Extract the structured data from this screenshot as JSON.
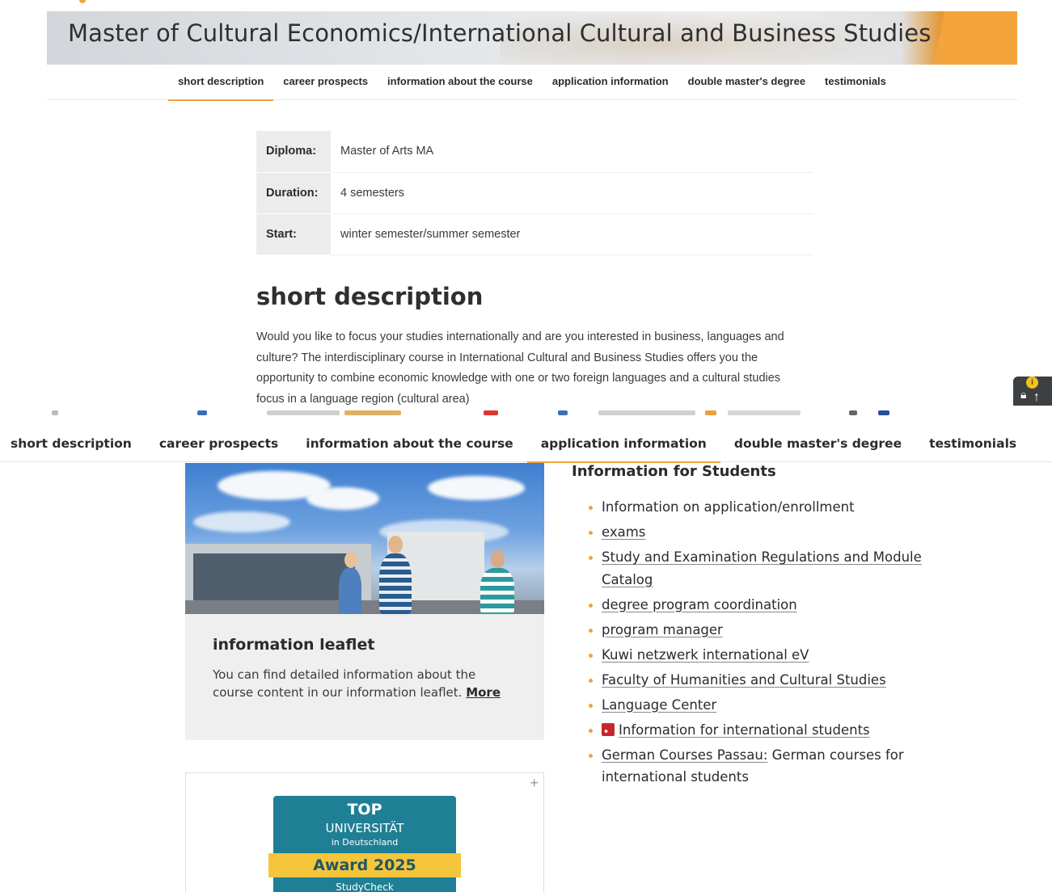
{
  "banner": {
    "title": "Master of Cultural Economics/International Cultural and Business Studies"
  },
  "tabs_top": [
    {
      "label": "short description",
      "active": true
    },
    {
      "label": "career prospects",
      "active": false
    },
    {
      "label": "information about the course",
      "active": false
    },
    {
      "label": "application information",
      "active": false
    },
    {
      "label": "double master's degree",
      "active": false
    },
    {
      "label": "testimonials",
      "active": false
    }
  ],
  "facts": [
    {
      "key": "Diploma:",
      "value": "Master of Arts MA"
    },
    {
      "key": "Duration:",
      "value": "4 semesters"
    },
    {
      "key": "Start:",
      "value": "winter semester/summer semester"
    }
  ],
  "short_description": {
    "heading": "short description",
    "text": "Would you like to focus your studies internationally and are you interested in business, languages and culture? The interdisciplinary course in International Cultural and Business Studies offers you the opportunity to combine economic knowledge with one or two foreign languages and a cultural studies focus in a language region (cultural area)"
  },
  "float_widget": {
    "badge": "i",
    "lock_icon": "lock-icon",
    "arrow_icon": "arrow-up-icon"
  },
  "tabs_bottom": [
    {
      "label": "short description",
      "active": false
    },
    {
      "label": "career prospects",
      "active": false
    },
    {
      "label": "information about the course",
      "active": false
    },
    {
      "label": "application information",
      "active": true
    },
    {
      "label": "double master's degree",
      "active": false
    },
    {
      "label": "testimonials",
      "active": false
    }
  ],
  "leaflet": {
    "heading": "information leaflet",
    "text": "You can find detailed information about the course content in our information leaflet. ",
    "more_label": "More"
  },
  "award": {
    "plus": "+",
    "top": "TOP",
    "university": "UNIVERSITÄT",
    "country": "in Deutschland",
    "year": "Award 2025",
    "source": "StudyCheck"
  },
  "students": {
    "heading": "Information for Students",
    "items": [
      {
        "label": "Information on application/enrollment",
        "link": false,
        "suffix": ""
      },
      {
        "label": "exams",
        "link": true,
        "suffix": ""
      },
      {
        "label": "Study and Examination Regulations and Module Catalog",
        "link": true,
        "suffix": ""
      },
      {
        "label": "degree program coordination",
        "link": true,
        "suffix": ""
      },
      {
        "label": "program manager",
        "link": true,
        "suffix": ""
      },
      {
        "label": "Kuwi netzwerk international eV",
        "link": true,
        "suffix": ""
      },
      {
        "label": "Faculty of Humanities and Cultural Studies",
        "link": true,
        "suffix": ""
      },
      {
        "label": "Language Center",
        "link": true,
        "suffix": ""
      },
      {
        "label": "Information for international students",
        "link": true,
        "suffix": "",
        "icon": "pdf-icon"
      },
      {
        "label": "German Courses Passau:",
        "link": true,
        "suffix": " German courses for international students"
      }
    ]
  },
  "colors": {
    "accent": "#f0a33c",
    "text": "#2b2b2b",
    "award_teal": "#1f7f94",
    "award_yellow": "#f5c53b",
    "pdf_red": "#c8242b"
  }
}
